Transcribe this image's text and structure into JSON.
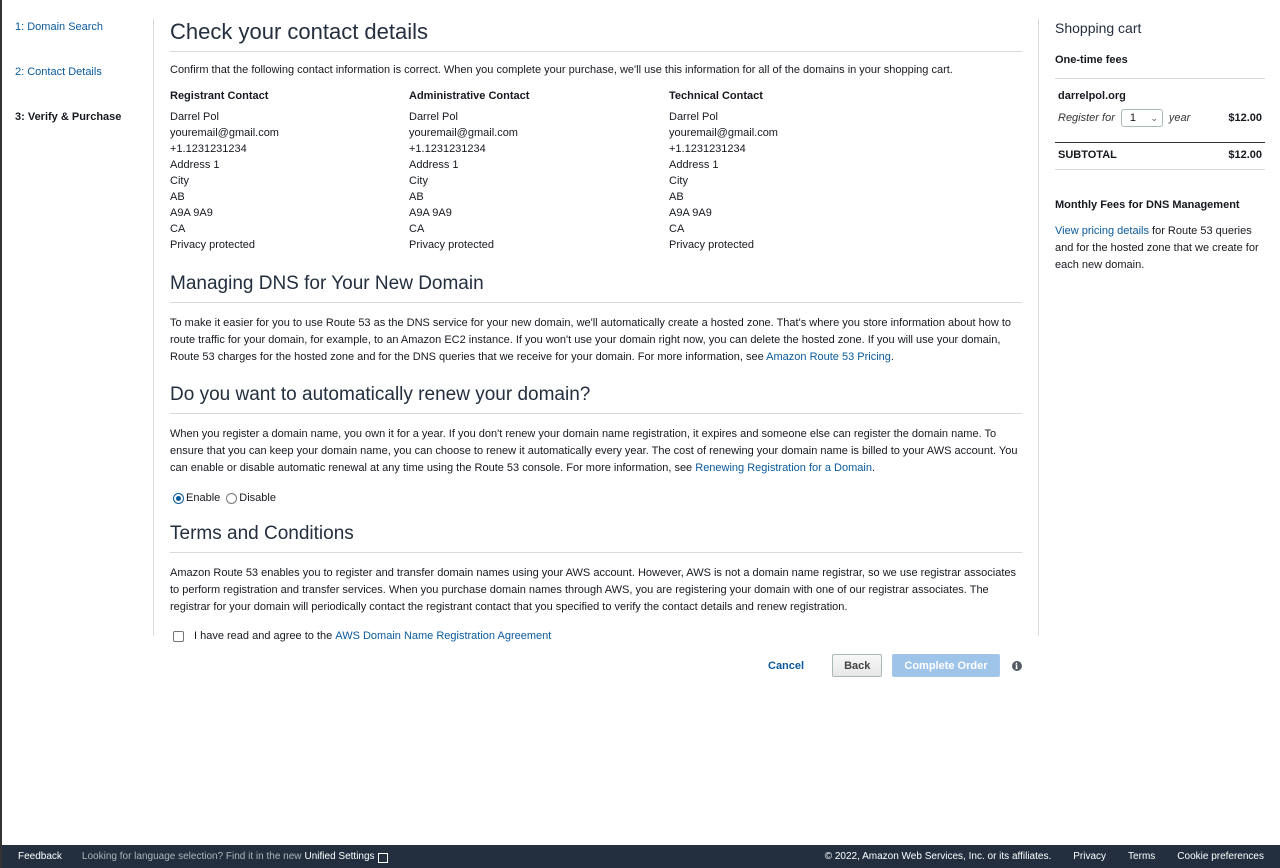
{
  "steps": [
    {
      "label": "1: Domain Search"
    },
    {
      "label": "2: Contact Details"
    },
    {
      "label": "3: Verify & Purchase"
    }
  ],
  "contact_section": {
    "title": "Check your contact details",
    "intro": "Confirm that the following contact information is correct. When you complete your purchase, we'll use this information for all of the domains in your shopping cart.",
    "columns": [
      {
        "title": "Registrant Contact",
        "lines": [
          "Darrel Pol",
          "youremail@gmail.com",
          "+1.1231231234",
          "Address 1",
          "City",
          "AB",
          "A9A 9A9",
          "CA",
          "Privacy protected"
        ]
      },
      {
        "title": "Administrative Contact",
        "lines": [
          "Darrel Pol",
          "youremail@gmail.com",
          "+1.1231231234",
          "Address 1",
          "City",
          "AB",
          "A9A 9A9",
          "CA",
          "Privacy protected"
        ]
      },
      {
        "title": "Technical Contact",
        "lines": [
          "Darrel Pol",
          "youremail@gmail.com",
          "+1.1231231234",
          "Address 1",
          "City",
          "AB",
          "A9A 9A9",
          "CA",
          "Privacy protected"
        ]
      }
    ]
  },
  "dns_section": {
    "title": "Managing DNS for Your New Domain",
    "text": "To make it easier for you to use Route 53 as the DNS service for your new domain, we'll automatically create a hosted zone. That's where you store information about how to route traffic for your domain, for example, to an Amazon EC2 instance. If you won't use your domain right now, you can delete the hosted zone. If you will use your domain, Route 53 charges for the hosted zone and for the DNS queries that we receive for your domain. For more information, see",
    "link": "Amazon Route 53 Pricing",
    "suffix": "."
  },
  "renew_section": {
    "title": "Do you want to automatically renew your domain?",
    "text": "When you register a domain name, you own it for a year. If you don't renew your domain name registration, it expires and someone else can register the domain name. To ensure that you can keep your domain name, you can choose to renew it automatically every year. The cost of renewing your domain name is billed to your AWS account. You can enable or disable automatic renewal at any time using the Route 53 console. For more information, see",
    "link": "Renewing Registration for a Domain",
    "suffix": ".",
    "enable_label": "Enable",
    "disable_label": "Disable",
    "selected": "Enable"
  },
  "terms_section": {
    "title": "Terms and Conditions",
    "text": "Amazon Route 53 enables you to register and transfer domain names using your AWS account. However, AWS is not a domain name registrar, so we use registrar associates to perform registration and transfer services. When you purchase domain names through AWS, you are registering your domain with one of our registrar associates. The registrar for your domain will periodically contact the registrant contact that you specified to verify the contact details and renew registration.",
    "agree_prefix": "I have read and agree to the",
    "agree_link": "AWS Domain Name Registration Agreement",
    "agree_checked": false
  },
  "actions": {
    "cancel": "Cancel",
    "back": "Back",
    "complete": "Complete Order",
    "info_icon": "info-icon"
  },
  "cart": {
    "title": "Shopping cart",
    "one_time_label": "One-time fees",
    "domain": "darrelpol.org",
    "register_for": "Register for",
    "years_value": "1",
    "year_label": "year",
    "price": "$12.00",
    "subtotal_label": "SUBTOTAL",
    "subtotal_value": "$12.00",
    "monthly_title": "Monthly Fees for DNS Management",
    "monthly_link": "View pricing details",
    "monthly_text": "for Route 53 queries and for the hosted zone that we create for each new domain."
  },
  "footer": {
    "feedback": "Feedback",
    "lang_prompt": "Looking for language selection? Find it in the new",
    "unified": "Unified Settings",
    "copyright": "© 2022, Amazon Web Services, Inc. or its affiliates.",
    "privacy": "Privacy",
    "terms": "Terms",
    "cookies": "Cookie preferences"
  }
}
